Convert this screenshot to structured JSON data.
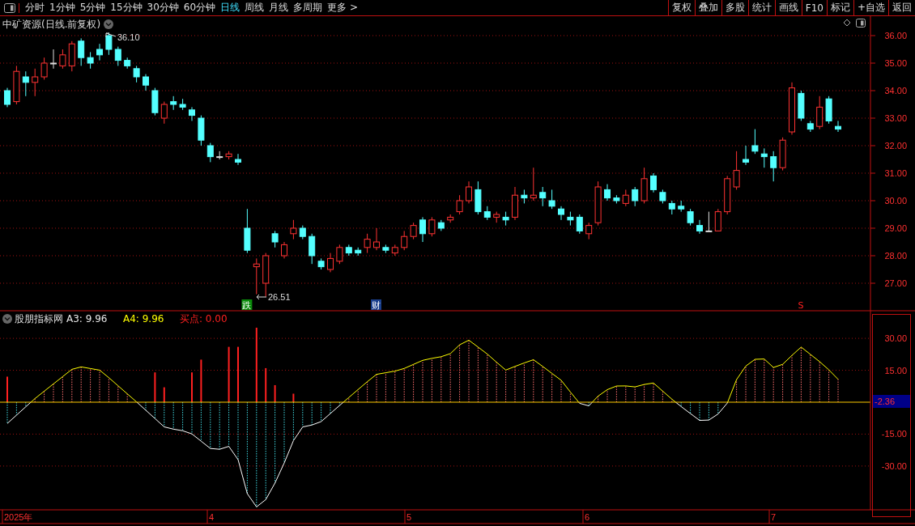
{
  "toolbar": {
    "periods": [
      {
        "label": "分时",
        "selected": false
      },
      {
        "label": "1分钟",
        "selected": false
      },
      {
        "label": "5分钟",
        "selected": false
      },
      {
        "label": "15分钟",
        "selected": false
      },
      {
        "label": "30分钟",
        "selected": false
      },
      {
        "label": "60分钟",
        "selected": false
      },
      {
        "label": "日线",
        "selected": true
      },
      {
        "label": "周线",
        "selected": false
      },
      {
        "label": "月线",
        "selected": false
      },
      {
        "label": "多周期",
        "selected": false
      },
      {
        "label": "更多 >",
        "selected": false
      }
    ],
    "actions": [
      "复权",
      "叠加",
      "多股",
      "统计",
      "画线",
      "F10",
      "标记",
      "+自选",
      "返回"
    ]
  },
  "price_panel": {
    "title": "中矿资源(日线.前复权)",
    "high_label": "36.10",
    "low_label": "26.51",
    "y_ticks": [
      "36.00",
      "35.00",
      "34.00",
      "33.00",
      "32.00",
      "31.00",
      "30.00",
      "29.00",
      "28.00",
      "27.00"
    ],
    "event_tags": [
      {
        "label": "跌",
        "kind": "down"
      },
      {
        "label": "财",
        "kind": "finance"
      },
      {
        "label": "S",
        "kind": "signal"
      }
    ]
  },
  "indicator": {
    "name": "股朋指标网",
    "readouts": [
      {
        "label": "A3: 9.96",
        "color": "#e8e8e8"
      },
      {
        "label": "A4: 9.96",
        "color": "#ffff00"
      },
      {
        "label": "买点: 0.00",
        "color": "#ff2020"
      }
    ],
    "y_ticks": [
      "30.00",
      "15.00",
      "-15.00",
      "-30.00"
    ],
    "current_value": "-2.36"
  },
  "time_axis": {
    "labels": [
      "2025年",
      "4",
      "5",
      "6",
      "7"
    ]
  }
}
